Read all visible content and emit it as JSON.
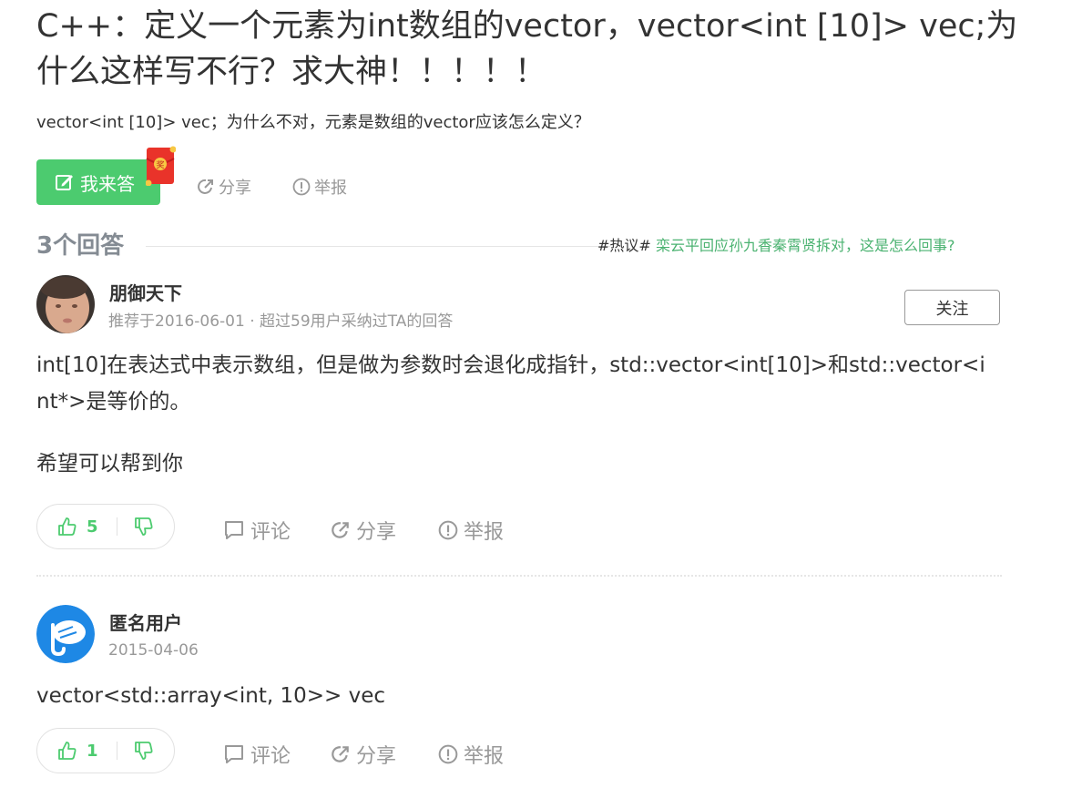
{
  "question": {
    "title": "C++：定义一个元素为int数组的vector，vector<int [10]> vec;为什么这样写不行？求大神！！！！！",
    "description": "vector<int [10]> vec；为什么不对，元素是数组的vector应该怎么定义？"
  },
  "actions": {
    "answer_label": "我来答",
    "redpack_label": "奖",
    "share_label": "分享",
    "report_label": "举报"
  },
  "answers_header": {
    "count_label": "3个回答",
    "hot_tag": "#热议#",
    "hot_link": "栾云平回应孙九香秦霄贤拆对，这是怎么回事?"
  },
  "answers": [
    {
      "username": "朋御天下",
      "meta": "推荐于2016-06-01 · 超过59用户采纳过TA的回答",
      "follow_label": "关注",
      "text_line1": "int[10]在表达式中表示数组，但是做为参数时会退化成指针，std::vector<int[10]>和std::vector<i",
      "text_line2": "nt*>是等价的。",
      "text_line3": "希望可以帮到你",
      "likes": "5",
      "comment_label": "评论",
      "share_label": "分享",
      "report_label": "举报"
    },
    {
      "username": "匿名用户",
      "meta": "2015-04-06",
      "text_line1": "vector<std::array<int, 10>> vec",
      "likes": "1",
      "comment_label": "评论",
      "share_label": "分享",
      "report_label": "举报"
    }
  ],
  "colors": {
    "accent_green": "#4ccb6f",
    "link_green": "#4ab270",
    "muted_gray": "#999999"
  }
}
